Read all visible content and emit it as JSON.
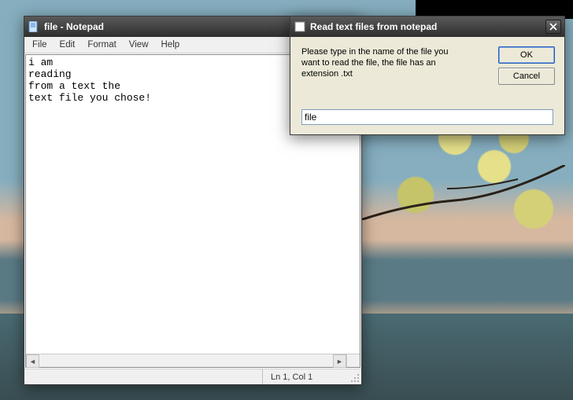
{
  "notepad": {
    "title": "file - Notepad",
    "menu": {
      "file": "File",
      "edit": "Edit",
      "format": "Format",
      "view": "View",
      "help": "Help"
    },
    "content": "i am\nreading\nfrom a text the\ntext file you chose!",
    "status": "Ln 1, Col 1"
  },
  "dialog": {
    "title": "Read text files from notepad",
    "prompt": "Please type in the name of the file you want to read the file, the file has an extension .txt",
    "ok": "OK",
    "cancel": "Cancel",
    "input_value": "file"
  }
}
